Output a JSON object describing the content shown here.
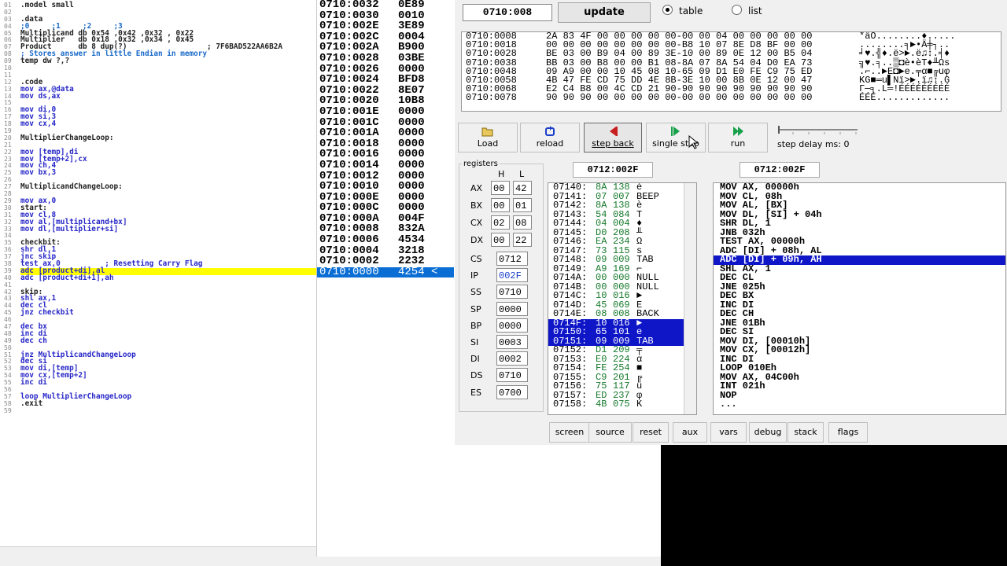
{
  "editor": {
    "line_numbers": [
      "01",
      "02",
      "03",
      "04",
      "05",
      "06",
      "07",
      "08",
      "09",
      "10",
      "11",
      "12",
      "13",
      "14",
      "15",
      "16",
      "17",
      "18",
      "19",
      "20",
      "21",
      "22",
      "23",
      "24",
      "25",
      "26",
      "27",
      "28",
      "29",
      "30",
      "31",
      "32",
      "33",
      "34",
      "35",
      "36",
      "37",
      "38",
      "39",
      "40",
      "41",
      "42",
      "43",
      "44",
      "45",
      "46",
      "47",
      "48",
      "49",
      "50",
      "51",
      "52",
      "53",
      "54",
      "55",
      "56",
      "57",
      "58",
      "59"
    ],
    "lines": [
      ".model small",
      "",
      ".data",
      ";0     ;1     ;2     ;3",
      "Multiplicand db 0x54 ,0x42 ,0x32 , 0x22",
      "Multiplier   db 0x18 ,0x32 ,0x34 , 0x45",
      "Product      db 8 dup(?)                  ; 7F6BAD522AA6B2A",
      "; Stores answer in little Endian in memory",
      "temp dw ?,?",
      "",
      "",
      ".code",
      "mov ax,@data",
      "mov ds,ax",
      "",
      "mov di,0",
      "mov si,3",
      "mov cx,4",
      "",
      "MultiplierChangeLoop:",
      "",
      "mov [temp],di",
      "mov [temp+2],cx",
      "mov ch,4",
      "mov bx,3",
      "",
      "MultiplicandChangeLoop:",
      "",
      "mov ax,0",
      "start:",
      "mov cl,8",
      "mov al,[multiplicand+bx]",
      "mov dl,[multiplier+si]",
      "",
      "checkbit:",
      "shr dl,1",
      "jnc skip",
      "test ax,0          ; Resetting Carry Flag",
      "adc [product+di],al",
      "adc [product+di+1],ah",
      "",
      "skip:",
      "shl ax,1",
      "dec cl",
      "jnz checkbit",
      "",
      "dec bx",
      "inc di",
      "dec ch",
      "",
      "jnz MultiplicandChangeLoop",
      "dec si",
      "mov di,[temp]",
      "mov cx,[temp+2]",
      "inc di",
      "",
      "loop MultiplierChangeLoop",
      ".exit",
      ""
    ]
  },
  "memlist": {
    "rows": [
      {
        "addr": "0710:0032",
        "val": "0E89"
      },
      {
        "addr": "0710:0030",
        "val": "0010"
      },
      {
        "addr": "0710:002E",
        "val": "3E89"
      },
      {
        "addr": "0710:002C",
        "val": "0004"
      },
      {
        "addr": "0710:002A",
        "val": "B900"
      },
      {
        "addr": "0710:0028",
        "val": "03BE"
      },
      {
        "addr": "0710:0026",
        "val": "0000"
      },
      {
        "addr": "0710:0024",
        "val": "BFD8"
      },
      {
        "addr": "0710:0022",
        "val": "8E07"
      },
      {
        "addr": "0710:0020",
        "val": "10B8"
      },
      {
        "addr": "0710:001E",
        "val": "0000"
      },
      {
        "addr": "0710:001C",
        "val": "0000"
      },
      {
        "addr": "0710:001A",
        "val": "0000"
      },
      {
        "addr": "0710:0018",
        "val": "0000"
      },
      {
        "addr": "0710:0016",
        "val": "0000"
      },
      {
        "addr": "0710:0014",
        "val": "0000"
      },
      {
        "addr": "0710:0012",
        "val": "0000"
      },
      {
        "addr": "0710:0010",
        "val": "0000"
      },
      {
        "addr": "0710:000E",
        "val": "0000"
      },
      {
        "addr": "0710:000C",
        "val": "0000"
      },
      {
        "addr": "0710:000A",
        "val": "004F"
      },
      {
        "addr": "0710:0008",
        "val": "832A"
      },
      {
        "addr": "0710:0006",
        "val": "4534"
      },
      {
        "addr": "0710:0004",
        "val": "3218"
      },
      {
        "addr": "0710:0002",
        "val": "2232"
      },
      {
        "addr": "0710:0000",
        "val": "4254 <"
      }
    ]
  },
  "emu": {
    "address_value": "0710:008",
    "update_label": "update",
    "view_table": "table",
    "view_list": "list",
    "dump": [
      {
        "addr": "0710:0008",
        "bytes": "2A 83 4F 00 00 00 00 00-00 00 04 00 00 00 00 00",
        "ascii": "*âO........♦....."
      },
      {
        "addr": "0710:0018",
        "bytes": "00 00 00 00 00 00 00 00-B8 10 07 8E D8 BF 00 00",
        "ascii": "........╕►•Ä╪┐.."
      },
      {
        "addr": "0710:0028",
        "bytes": "BE 03 00 B9 04 00 89 3E-10 00 89 0E 12 00 B5 04",
        "ascii": "╛♥.╣♦.ë>►.ë♫↕.╡♦"
      },
      {
        "addr": "0710:0038",
        "bytes": "BB 03 00 B8 00 00 B1 08-8A 07 8A 54 04 D0 EA 73",
        "ascii": "╗♥.╕..▒◘è•èT♦╨Ωs"
      },
      {
        "addr": "0710:0048",
        "bytes": "09 A9 00 00 10 45 08 10-65 09 D1 E0 FE C9 75 ED",
        "ascii": ".⌐..►E◘►e.╤α■╔uφ"
      },
      {
        "addr": "0710:0058",
        "bytes": "4B 47 FE CD 75 DD 4E 8B-3E 10 00 8B 0E 12 00 47",
        "ascii": "KG■═u▌Nï>►.ï♫↕.G"
      },
      {
        "addr": "0710:0068",
        "bytes": "E2 C4 B8 00 4C CD 21 90-90 90 90 90 90 90 90 90",
        "ascii": "Γ─╕.L═!ÉÉÉÉÉÉÉÉÉ"
      },
      {
        "addr": "0710:0078",
        "bytes": "90 90 90 00 00 00 00 00-00 00 00 00 00 00 00 00",
        "ascii": "ÉÉÉ............."
      }
    ],
    "toolbar": {
      "load": "Load",
      "reload": "reload",
      "step_back": "step back",
      "single_step": "single step",
      "run": "run",
      "step_delay": "step delay ms: 0"
    },
    "registers": {
      "title": "registers",
      "h": "H",
      "l": "L",
      "ax": {
        "name": "AX",
        "h": "00",
        "l": "42"
      },
      "bx": {
        "name": "BX",
        "h": "00",
        "l": "01"
      },
      "cx": {
        "name": "CX",
        "h": "02",
        "l": "08"
      },
      "dx": {
        "name": "DX",
        "h": "00",
        "l": "22"
      },
      "cs": {
        "name": "CS",
        "v": "0712"
      },
      "ip": {
        "name": "IP",
        "v": "002F"
      },
      "ss": {
        "name": "SS",
        "v": "0710"
      },
      "sp": {
        "name": "SP",
        "v": "0000"
      },
      "bp": {
        "name": "BP",
        "v": "0000"
      },
      "si": {
        "name": "SI",
        "v": "0003"
      },
      "di": {
        "name": "DI",
        "v": "0002"
      },
      "ds": {
        "name": "DS",
        "v": "0710"
      },
      "es": {
        "name": "ES",
        "v": "0700"
      }
    },
    "addr1": "0712:002F",
    "addr2": "0712:002F",
    "bytes": [
      {
        "a": "07140:",
        "h": "8A",
        "d": "138",
        "c": "è"
      },
      {
        "a": "07141:",
        "h": "07",
        "d": "007",
        "c": "BEEP"
      },
      {
        "a": "07142:",
        "h": "8A",
        "d": "138",
        "c": "è"
      },
      {
        "a": "07143:",
        "h": "54",
        "d": "084",
        "c": "T"
      },
      {
        "a": "07144:",
        "h": "04",
        "d": "004",
        "c": "♦"
      },
      {
        "a": "07145:",
        "h": "D0",
        "d": "208",
        "c": "╨"
      },
      {
        "a": "07146:",
        "h": "EA",
        "d": "234",
        "c": "Ω"
      },
      {
        "a": "07147:",
        "h": "73",
        "d": "115",
        "c": "s"
      },
      {
        "a": "07148:",
        "h": "09",
        "d": "009",
        "c": "TAB"
      },
      {
        "a": "07149:",
        "h": "A9",
        "d": "169",
        "c": "⌐"
      },
      {
        "a": "0714A:",
        "h": "00",
        "d": "000",
        "c": "NULL"
      },
      {
        "a": "0714B:",
        "h": "00",
        "d": "000",
        "c": "NULL"
      },
      {
        "a": "0714C:",
        "h": "10",
        "d": "016",
        "c": "►"
      },
      {
        "a": "0714D:",
        "h": "45",
        "d": "069",
        "c": "E"
      },
      {
        "a": "0714E:",
        "h": "08",
        "d": "008",
        "c": "BACK"
      },
      {
        "a": "0714F:",
        "h": "10",
        "d": "016",
        "c": "►"
      },
      {
        "a": "07150:",
        "h": "65",
        "d": "101",
        "c": "e"
      },
      {
        "a": "07151:",
        "h": "09",
        "d": "009",
        "c": "TAB"
      },
      {
        "a": "07152:",
        "h": "D1",
        "d": "209",
        "c": "╤"
      },
      {
        "a": "07153:",
        "h": "E0",
        "d": "224",
        "c": "α"
      },
      {
        "a": "07154:",
        "h": "FE",
        "d": "254",
        "c": "■"
      },
      {
        "a": "07155:",
        "h": "C9",
        "d": "201",
        "c": "╔"
      },
      {
        "a": "07156:",
        "h": "75",
        "d": "117",
        "c": "u"
      },
      {
        "a": "07157:",
        "h": "ED",
        "d": "237",
        "c": "φ"
      },
      {
        "a": "07158:",
        "h": "4B",
        "d": "075",
        "c": "K"
      }
    ],
    "disasm": [
      "MOV AX, 00000h",
      "MOV CL, 08h",
      "MOV AL, [BX]",
      "MOV DL, [SI] + 04h",
      "SHR DL, 1",
      "JNB 032h",
      "TEST AX, 00000h",
      "ADC [DI] + 08h, AL",
      "ADC [DI] + 09h, AH",
      "SHL AX, 1",
      "DEC CL",
      "JNE 025h",
      "DEC BX",
      "INC DI",
      "DEC CH",
      "JNE 01Bh",
      "DEC SI",
      "MOV DI, [00010h]",
      "MOV CX, [00012h]",
      "INC DI",
      "LOOP 010Eh",
      "MOV AX, 04C00h",
      "INT 021h",
      "NOP",
      "..."
    ],
    "bottom": [
      "screen",
      "source",
      "reset",
      "aux",
      "vars",
      "debug",
      "stack",
      "flags"
    ]
  }
}
